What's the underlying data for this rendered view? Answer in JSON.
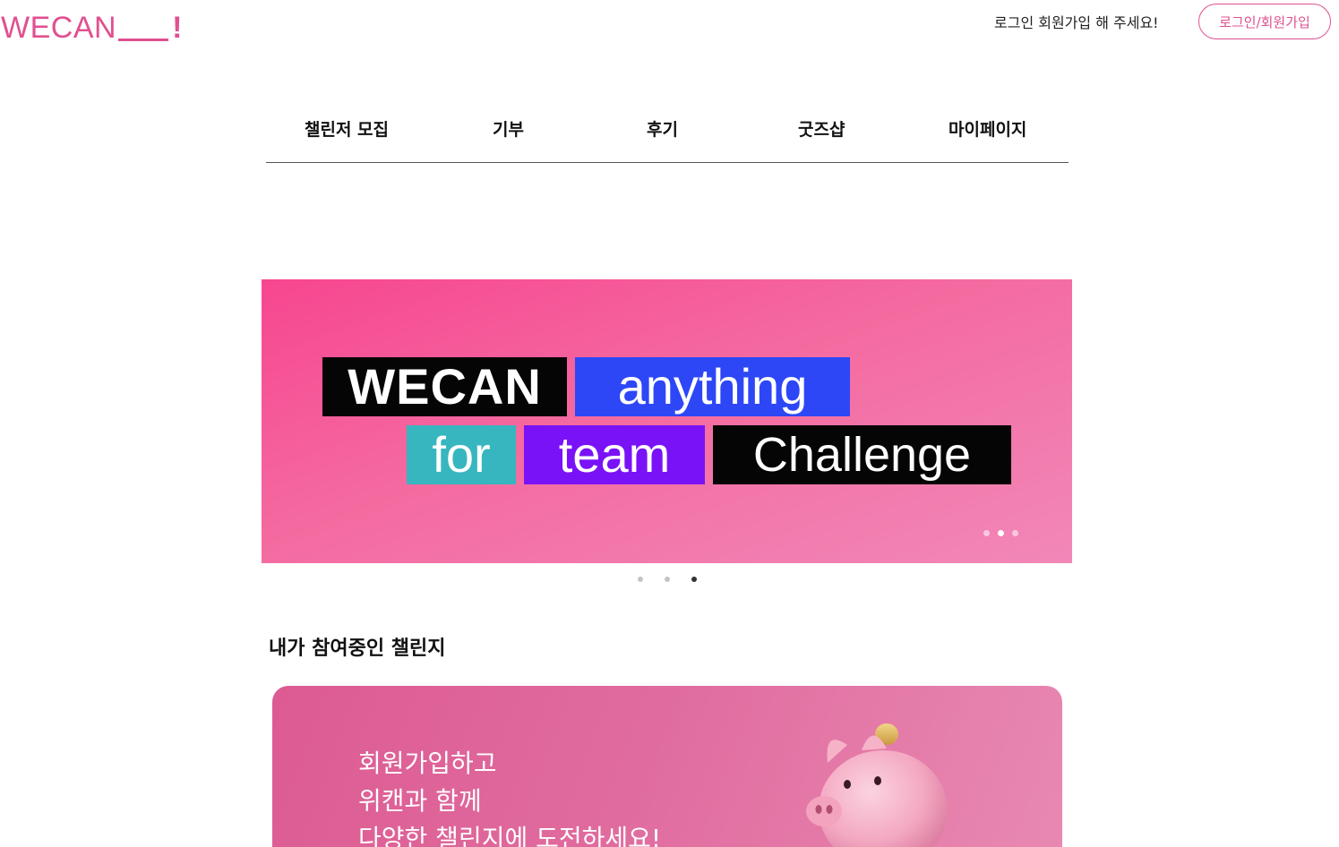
{
  "header": {
    "logo_text": "WECAN",
    "logo_suffix": "!",
    "greeting": "로그인 회원가입 해 주세요!",
    "auth_button": "로그인/회원가입"
  },
  "nav": {
    "items": [
      {
        "label": "챌린저 모집"
      },
      {
        "label": "기부"
      },
      {
        "label": "후기"
      },
      {
        "label": "굿즈샵"
      },
      {
        "label": "마이페이지"
      }
    ]
  },
  "hero": {
    "words": [
      "WECAN",
      "anything",
      "for",
      "team",
      "Challenge"
    ],
    "slide_count": 3,
    "active_slide": 2
  },
  "pagination": {
    "count": 3,
    "active_index": 2
  },
  "section": {
    "title": "내가 참여중인 챌린지"
  },
  "promo": {
    "lines": [
      "회원가입하고",
      "위캔과 함께",
      "다양한 챌린지에 도전하세요!"
    ]
  },
  "colors": {
    "brand": "#e0508f",
    "hero_pink": "#f7468f",
    "tag_black": "#050505",
    "tag_blue": "#2d47f7",
    "tag_teal": "#37b6bf",
    "tag_purple": "#7a12f7"
  }
}
